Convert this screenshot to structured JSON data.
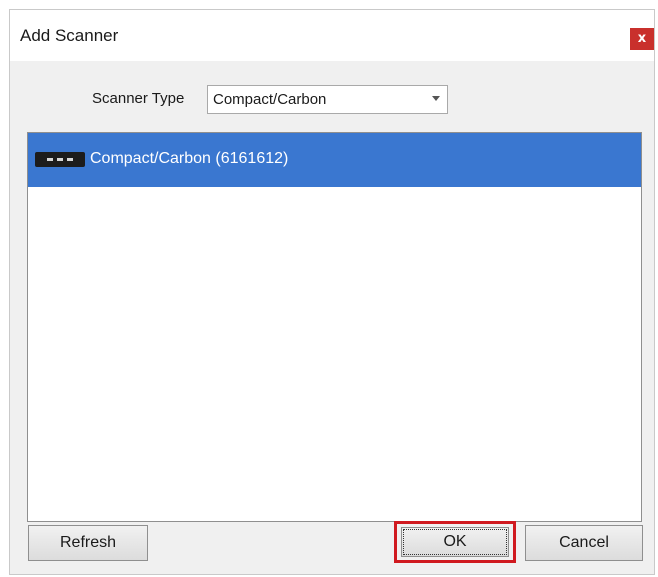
{
  "dialog": {
    "title": "Add Scanner",
    "close_label": "x"
  },
  "scanner_type": {
    "label": "Scanner Type",
    "selected": "Compact/Carbon"
  },
  "scanner_list": {
    "items": [
      {
        "label": "Compact/Carbon (6161612)",
        "selected": true,
        "icon": "scanner-icon"
      }
    ]
  },
  "buttons": {
    "refresh": "Refresh",
    "ok": "OK",
    "cancel": "Cancel"
  },
  "colors": {
    "selection": "#3a77d0",
    "close_button": "#c9302c",
    "highlight_box": "#d0191f"
  }
}
